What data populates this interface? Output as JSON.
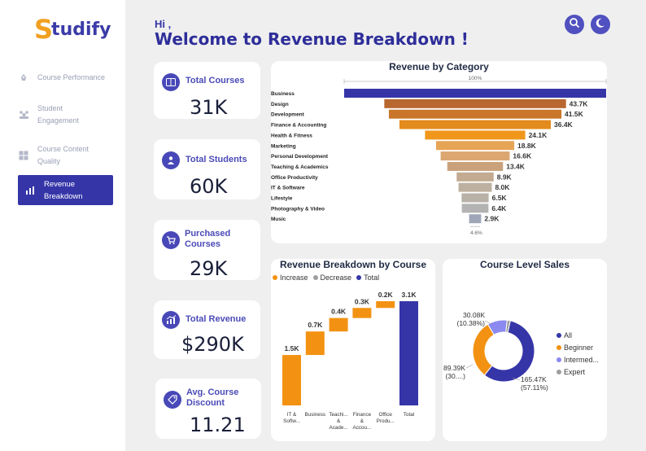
{
  "brand": {
    "first_letter": "S",
    "rest": "tudify"
  },
  "nav": {
    "items": [
      {
        "label_1": "Course Performance",
        "label_2": ""
      },
      {
        "label_1": "Student",
        "label_2": "Engagement"
      },
      {
        "label_1": "Course Content",
        "label_2": "Quality"
      },
      {
        "label_1": "Revenue Breakdown",
        "label_2": ""
      }
    ]
  },
  "header": {
    "greeting": "Hi ,",
    "title": "Welcome to Revenue Breakdown !"
  },
  "kpis": [
    {
      "label_1": "Total Courses",
      "label_2": "",
      "value": "31K",
      "icon": "book-icon"
    },
    {
      "label_1": "Total Students",
      "label_2": "",
      "value": "60K",
      "icon": "users-icon"
    },
    {
      "label_1": "Purchased",
      "label_2": "Courses",
      "value": "29K",
      "icon": "cart-icon"
    },
    {
      "label_1": "Total Revenue",
      "label_2": "",
      "value": "$290K",
      "icon": "trend-icon"
    },
    {
      "label_1": "Avg. Course",
      "label_2": "Discount",
      "value": "11.21",
      "icon": "discount-icon"
    }
  ],
  "colors": {
    "primary": "#3535a8",
    "accent": "#f39212",
    "grey": "#9e9e9e"
  },
  "chart_data": [
    {
      "type": "bar",
      "title": "Revenue by Category",
      "top_label": "100%",
      "bottom_label": "4.6%",
      "categories": [
        "Business",
        "Design",
        "Development",
        "Finance & Accounting",
        "Health & Fitness",
        "Marketing",
        "Personal Development",
        "Teaching & Academics",
        "Office Productivity",
        "IT & Software",
        "Lifestyle",
        "Photography & Video",
        "Music"
      ],
      "values": [
        63.0,
        43.7,
        41.5,
        36.4,
        24.1,
        18.8,
        16.6,
        13.4,
        8.9,
        8.0,
        6.5,
        6.4,
        2.9
      ],
      "data_labels": [
        "",
        "43.7K",
        "41.5K",
        "36.4K",
        "24.1K",
        "18.8K",
        "16.6K",
        "13.4K",
        "8.9K",
        "8.0K",
        "6.5K",
        "6.4K",
        "2.9K"
      ],
      "bar_colors": [
        "#3535a8",
        "#b8672e",
        "#c9762a",
        "#e38b1c",
        "#f0961a",
        "#e6a455",
        "#dba670",
        "#c9a27c",
        "#c2ab90",
        "#bdb0a0",
        "#b7b1a8",
        "#b3b3b3",
        "#9fa6b8"
      ]
    },
    {
      "type": "bar",
      "title": "Revenue Breakdown by Course",
      "legend": [
        {
          "name": "Increase",
          "color": "#f39212"
        },
        {
          "name": "Decrease",
          "color": "#9e9e9e"
        },
        {
          "name": "Total",
          "color": "#3535a8"
        }
      ],
      "categories": [
        [
          "IT &",
          "Softw..."
        ],
        [
          "Business"
        ],
        [
          "Teachi...",
          "&",
          "Acade..."
        ],
        [
          "Finance",
          "&",
          "Accou..."
        ],
        [
          "Office",
          "Produ..."
        ],
        [
          "Total"
        ]
      ],
      "values": [
        1.5,
        0.7,
        0.4,
        0.3,
        0.2,
        3.1
      ],
      "kind": [
        "increase",
        "increase",
        "increase",
        "increase",
        "increase",
        "total"
      ],
      "data_labels": [
        "1.5K",
        "0.7K",
        "0.4K",
        "0.3K",
        "0.2K",
        "3.1K"
      ]
    },
    {
      "type": "pie",
      "title": "Course Level Sales",
      "legend": [
        {
          "name": "All",
          "color": "#3535a8"
        },
        {
          "name": "Beginner",
          "color": "#f39212"
        },
        {
          "name": "Intermed...",
          "color": "#8a8af0"
        },
        {
          "name": "Expert",
          "color": "#9e9e9e"
        }
      ],
      "slices": [
        {
          "name": "All",
          "value": 165.47,
          "percent": 57.11,
          "color": "#3535a8",
          "label_1": "165.47K",
          "label_2": "(57.11%)"
        },
        {
          "name": "Beginner",
          "value": 89.39,
          "percent": 30.85,
          "color": "#f39212",
          "label_1": "89.39K",
          "label_2": "(30....)"
        },
        {
          "name": "Intermed...",
          "value": 30.08,
          "percent": 10.38,
          "color": "#8a8af0",
          "label_1": "30.08K",
          "label_2": "(10.38%)"
        },
        {
          "name": "Expert",
          "value": 4.8,
          "percent": 1.66,
          "color": "#9e9e9e",
          "label_1": "",
          "label_2": ""
        }
      ]
    }
  ]
}
